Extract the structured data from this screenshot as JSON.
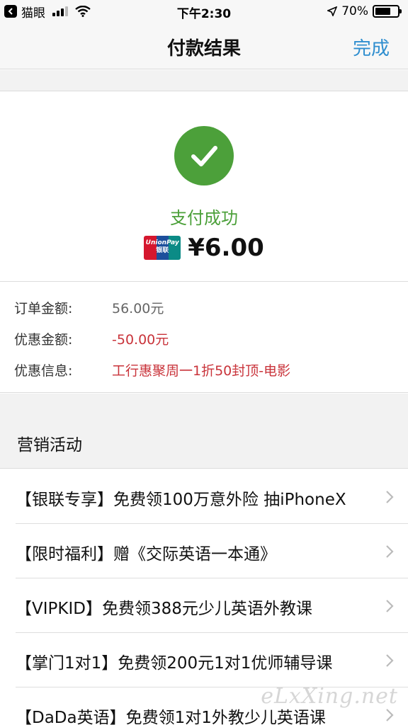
{
  "status_bar": {
    "app_name": "猫眼",
    "time": "下午2:30",
    "battery": "70%",
    "battery_level": 0.7
  },
  "nav": {
    "title": "付款结果",
    "done": "完成"
  },
  "result": {
    "status": "支付成功",
    "amount": "¥6.00",
    "card_brand_en": "UnionPay",
    "card_brand_cn": "银联"
  },
  "details": [
    {
      "label": "订单金额:",
      "value": "56.00元",
      "highlight": false
    },
    {
      "label": "优惠金额:",
      "value": "-50.00元",
      "highlight": true
    },
    {
      "label": "优惠信息:",
      "value": "工行惠聚周一1折50封顶-电影",
      "highlight": true
    }
  ],
  "promotions": {
    "title": "营销活动",
    "items": [
      "【银联专享】免费领100万意外险 抽iPhoneX",
      "【限时福利】赠《交际英语一本通》",
      "【VIPKID】免费领388元少儿英语外教课",
      "【掌门1对1】免费领200元1对1优师辅导课",
      "【DaDa英语】免费领1对1外教少儿英语课"
    ]
  },
  "watermark": "eLxXing.net",
  "colors": {
    "success": "#4ca03a",
    "link": "#2f8ecf",
    "discount": "#c9333a"
  }
}
